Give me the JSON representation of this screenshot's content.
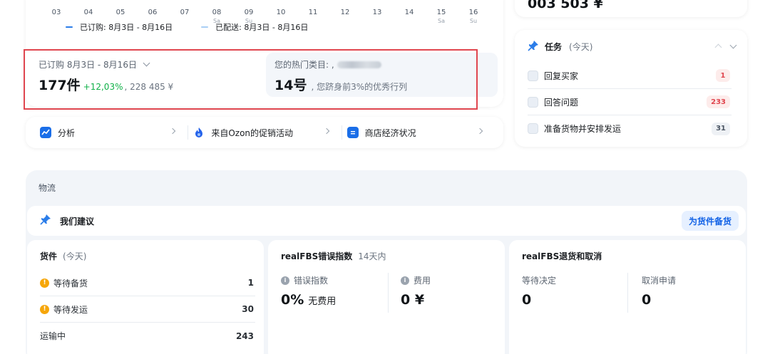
{
  "chart": {
    "days": [
      {
        "label": "03",
        "sub": ""
      },
      {
        "label": "04",
        "sub": ""
      },
      {
        "label": "05",
        "sub": ""
      },
      {
        "label": "06",
        "sub": ""
      },
      {
        "label": "07",
        "sub": ""
      },
      {
        "label": "08",
        "sub": "Sa"
      },
      {
        "label": "09",
        "sub": "Su"
      },
      {
        "label": "10",
        "sub": ""
      },
      {
        "label": "11",
        "sub": ""
      },
      {
        "label": "12",
        "sub": ""
      },
      {
        "label": "13",
        "sub": ""
      },
      {
        "label": "14",
        "sub": ""
      },
      {
        "label": "15",
        "sub": "Sa"
      },
      {
        "label": "16",
        "sub": "Su"
      }
    ],
    "legend": [
      {
        "label": "已订购: 8月3日 - 8月16日",
        "color": "#2b7de9"
      },
      {
        "label": "已配送: 8月3日 - 8月16日",
        "color": "#a9cff5"
      }
    ]
  },
  "stats": {
    "ordered_label": "已订购 8月3日 - 8月16日",
    "ordered_count": "177件",
    "ordered_change": "+12,03%",
    "ordered_amount": ", 228 485 ¥",
    "category_label": "您的热门类目: ,",
    "category_rank": "14号",
    "category_desc": ", 您跻身前3%的优秀行列"
  },
  "links": [
    {
      "label": "分析",
      "icon": "chart-icon",
      "color": "#1a6ee8"
    },
    {
      "label": "来自Ozon的促销活动",
      "icon": "fire-icon",
      "color": "#2563eb"
    },
    {
      "label": "商店经济状况",
      "icon": "document-icon",
      "color": "#1a6ee8"
    }
  ],
  "balance": {
    "value": "003 503 ¥"
  },
  "tasks": {
    "title": "任务",
    "subtitle": "(今天)",
    "items": [
      {
        "label": "回复买家",
        "count": "1",
        "badge_bg": "#fdeceb",
        "badge_color": "#e0464f"
      },
      {
        "label": "回答问题",
        "count": "233",
        "badge_bg": "#fdeceb",
        "badge_color": "#e0464f"
      },
      {
        "label": "准备货物并安排发运",
        "count": "31",
        "badge_bg": "#eef1f5",
        "badge_color": "#4b5563"
      }
    ]
  },
  "logistics": {
    "title": "物流",
    "suggest_title": "我们建议",
    "suggest_button": "为货件备货",
    "shipments": {
      "title": "货件",
      "subtitle": "(今天)",
      "rows": [
        {
          "label": "等待备货",
          "count": "1",
          "warn": true
        },
        {
          "label": "等待发运",
          "count": "30",
          "warn": true
        },
        {
          "label": "运输中",
          "count": "243",
          "warn": false
        }
      ]
    },
    "errors": {
      "title": "realFBS错误指数",
      "subtitle": "14天内",
      "metric1_label": "错误指数",
      "metric1_value": "0%",
      "metric1_note": "无费用",
      "metric2_label": "费用",
      "metric2_value": "0 ¥"
    },
    "returns": {
      "title": "realFBS退货和取消",
      "metric1_label": "等待决定",
      "metric1_value": "0",
      "metric2_label": "取消申请",
      "metric2_value": "0"
    }
  }
}
